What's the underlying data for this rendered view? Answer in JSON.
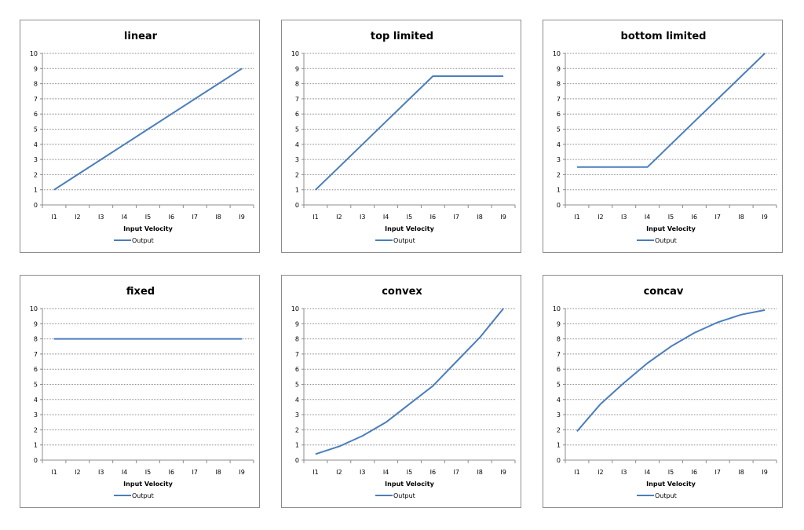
{
  "series_color": "#4a7ebb",
  "chart_data": [
    {
      "type": "line",
      "title": "linear",
      "xlabel": "Input Velocity",
      "ylabel": "",
      "categories": [
        "I1",
        "I2",
        "I3",
        "I4",
        "I5",
        "I6",
        "I7",
        "I8",
        "I9"
      ],
      "series": [
        {
          "name": "Output",
          "values": [
            1,
            2,
            3,
            4,
            5,
            6,
            7,
            8,
            9
          ]
        }
      ],
      "ylim": [
        0,
        10
      ],
      "yticks": [
        "0",
        "1",
        "2",
        "3",
        "4",
        "5",
        "6",
        "7",
        "8",
        "9",
        "10"
      ],
      "grid": true,
      "legend": "bottom"
    },
    {
      "type": "line",
      "title": "top limited",
      "xlabel": "Input Velocity",
      "ylabel": "",
      "categories": [
        "I1",
        "I2",
        "I3",
        "I4",
        "I5",
        "I6",
        "I7",
        "I8",
        "I9"
      ],
      "series": [
        {
          "name": "Output",
          "values": [
            1,
            2.5,
            4,
            5.5,
            7,
            8.5,
            8.5,
            8.5,
            8.5
          ]
        }
      ],
      "ylim": [
        0,
        10
      ],
      "yticks": [
        "0",
        "1",
        "2",
        "3",
        "4",
        "5",
        "6",
        "7",
        "8",
        "9",
        "10"
      ],
      "grid": true,
      "legend": "bottom"
    },
    {
      "type": "line",
      "title": "bottom limited",
      "xlabel": "Input Velocity",
      "ylabel": "",
      "categories": [
        "I1",
        "I2",
        "I3",
        "I4",
        "I5",
        "I6",
        "I7",
        "I8",
        "I9"
      ],
      "series": [
        {
          "name": "Output",
          "values": [
            2.5,
            2.5,
            2.5,
            2.5,
            4,
            5.5,
            7,
            8.5,
            10
          ]
        }
      ],
      "ylim": [
        0,
        10
      ],
      "yticks": [
        "0",
        "1",
        "2",
        "3",
        "4",
        "5",
        "6",
        "7",
        "8",
        "9",
        "10"
      ],
      "grid": true,
      "legend": "bottom"
    },
    {
      "type": "line",
      "title": "fixed",
      "xlabel": "Input Velocity",
      "ylabel": "",
      "categories": [
        "I1",
        "I2",
        "I3",
        "I4",
        "I5",
        "I6",
        "I7",
        "I8",
        "I9"
      ],
      "series": [
        {
          "name": "Output",
          "values": [
            8,
            8,
            8,
            8,
            8,
            8,
            8,
            8,
            8
          ]
        }
      ],
      "ylim": [
        0,
        10
      ],
      "yticks": [
        "0",
        "1",
        "2",
        "3",
        "4",
        "5",
        "6",
        "7",
        "8",
        "9",
        "10"
      ],
      "grid": true,
      "legend": "bottom"
    },
    {
      "type": "line",
      "title": "convex",
      "xlabel": "Input Velocity",
      "ylabel": "",
      "categories": [
        "I1",
        "I2",
        "I3",
        "I4",
        "I5",
        "I6",
        "I7",
        "I8",
        "I9"
      ],
      "series": [
        {
          "name": "Output",
          "values": [
            0.4,
            0.9,
            1.6,
            2.5,
            3.7,
            4.9,
            6.5,
            8.1,
            10
          ]
        }
      ],
      "ylim": [
        0,
        10
      ],
      "yticks": [
        "0",
        "1",
        "2",
        "3",
        "4",
        "5",
        "6",
        "7",
        "8",
        "9",
        "10"
      ],
      "grid": true,
      "legend": "bottom"
    },
    {
      "type": "line",
      "title": "concav",
      "xlabel": "Input Velocity",
      "ylabel": "",
      "categories": [
        "I1",
        "I2",
        "I3",
        "I4",
        "I5",
        "I6",
        "I7",
        "I8",
        "I9"
      ],
      "series": [
        {
          "name": "Output",
          "values": [
            1.9,
            3.7,
            5.1,
            6.4,
            7.5,
            8.4,
            9.1,
            9.6,
            9.9
          ]
        }
      ],
      "ylim": [
        0,
        10
      ],
      "yticks": [
        "0",
        "1",
        "2",
        "3",
        "4",
        "5",
        "6",
        "7",
        "8",
        "9",
        "10"
      ],
      "grid": true,
      "legend": "bottom"
    }
  ]
}
